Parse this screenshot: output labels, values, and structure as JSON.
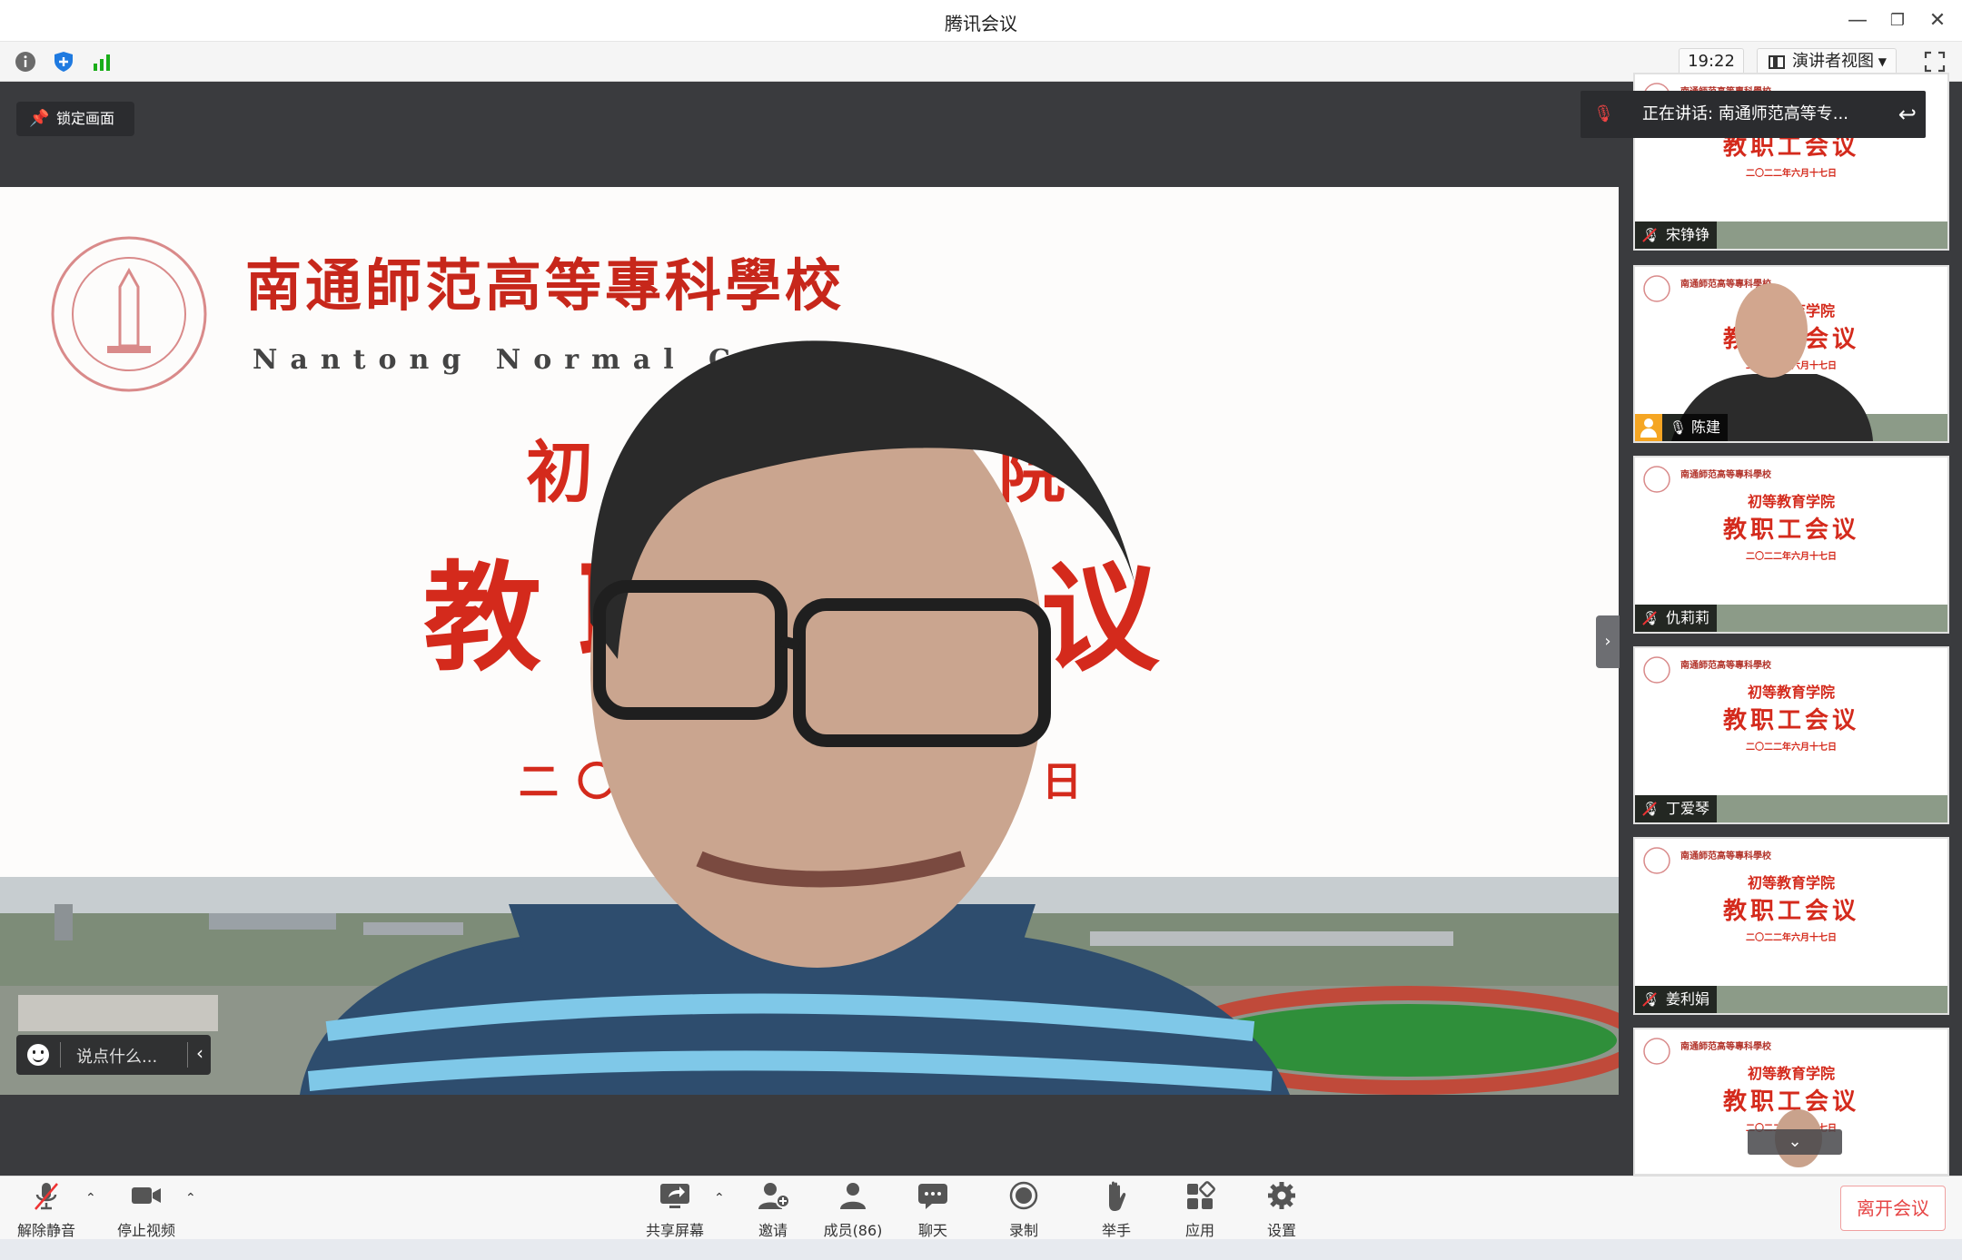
{
  "window": {
    "title": "腾讯会议"
  },
  "infobar": {
    "time": "19:22",
    "view_mode": "演讲者视图"
  },
  "stage": {
    "lock_label": "锁定画面",
    "chat_placeholder": "说点什么...",
    "speaking_now": "正在讲话: 南通师范高等专..."
  },
  "slide": {
    "school_cn": "南通師范高等專科學校",
    "school_en": "Nantong Normal College",
    "dept": "初等教育学院",
    "meeting": "教职工会议",
    "date": "二〇二二年六月十七日"
  },
  "participants": [
    {
      "name": "宋铮铮",
      "muted": true
    },
    {
      "name": "陈建",
      "muted": false,
      "video": true
    },
    {
      "name": "仇莉莉",
      "muted": true
    },
    {
      "name": "丁爱琴",
      "muted": true
    },
    {
      "name": "姜利娟",
      "muted": true
    },
    {
      "name": "",
      "muted": true
    }
  ],
  "toolbar": {
    "unmute": "解除静音",
    "stop_video": "停止视频",
    "share": "共享屏幕",
    "invite": "邀请",
    "members": "成员(86)",
    "chat": "聊天",
    "record": "录制",
    "raise_hand": "举手",
    "apps": "应用",
    "settings": "设置",
    "leave": "离开会议"
  },
  "colors": {
    "accent_red": "#d42a1c",
    "leave_red": "#e64545",
    "stage_bg": "#3a3b3e"
  }
}
